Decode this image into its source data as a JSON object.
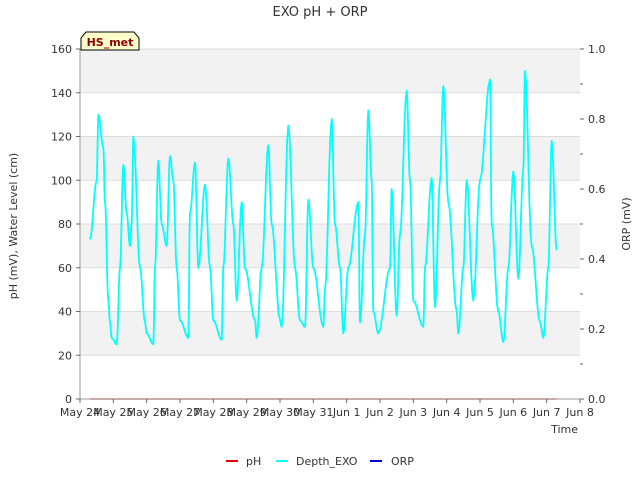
{
  "chart_data": {
    "type": "line",
    "title": "EXO pH + ORP",
    "xlabel": "Time",
    "ylabel_left": "pH (mV), Water Level (cm)",
    "ylabel_right": "ORP (mV)",
    "badge": "HS_met",
    "x_ticks": [
      "May 24",
      "May 25",
      "May 26",
      "May 27",
      "May 28",
      "May 29",
      "May 30",
      "May 31",
      "Jun 1",
      "Jun 2",
      "Jun 3",
      "Jun 4",
      "Jun 5",
      "Jun 6",
      "Jun 7",
      "Jun 8"
    ],
    "x_range_days": [
      0,
      15
    ],
    "y_left_ticks": [
      0,
      20,
      40,
      60,
      80,
      100,
      120,
      140,
      160
    ],
    "y_left_range": [
      0,
      160
    ],
    "y_right_ticks": [
      "0.0",
      "0.2",
      "0.4",
      "0.6",
      "0.8",
      "1.0"
    ],
    "y_right_range": [
      0,
      1.0
    ],
    "grid": true,
    "legend_placement": "bottom-center",
    "legend": [
      "pH",
      "Depth_EXO",
      "ORP"
    ],
    "series": [
      {
        "name": "pH",
        "color": "#dd0000",
        "axis": "left",
        "x": [
          0.3,
          14.3
        ],
        "values": [
          0,
          0
        ]
      },
      {
        "name": "Depth_EXO",
        "color": "#00ffff",
        "axis": "left",
        "x": [
          0.3,
          0.5,
          0.55,
          0.7,
          0.75,
          0.85,
          0.9,
          0.95,
          1.1,
          1.2,
          1.3,
          1.4,
          1.5,
          1.55,
          1.6,
          1.8,
          1.95,
          2.0,
          2.2,
          2.25,
          2.35,
          2.45,
          2.6,
          2.7,
          2.8,
          2.9,
          3.0,
          3.25,
          3.3,
          3.45,
          3.55,
          3.75,
          3.9,
          4.0,
          4.25,
          4.3,
          4.45,
          4.6,
          4.7,
          4.85,
          4.95,
          5.25,
          5.3,
          5.45,
          5.65,
          5.75,
          6.0,
          6.05,
          6.25,
          6.45,
          6.6,
          6.75,
          6.85,
          7.0,
          7.3,
          7.35,
          7.55,
          7.65,
          7.8,
          7.9,
          8.05,
          8.35,
          8.4,
          8.55,
          8.65,
          8.75,
          8.8,
          8.95,
          9.3,
          9.35,
          9.5,
          9.6,
          9.8,
          9.9,
          10.0,
          10.3,
          10.35,
          10.55,
          10.65,
          10.8,
          10.9,
          11.05,
          11.3,
          11.35,
          11.5,
          11.6,
          11.8,
          12.0,
          12.3,
          12.35,
          12.55,
          12.7,
          12.85,
          13.0,
          13.15,
          13.3,
          13.35,
          13.55,
          13.8,
          13.9,
          14.05,
          14.15,
          14.3
        ],
        "values": [
          73,
          100,
          130,
          115,
          90,
          45,
          35,
          28,
          25,
          60,
          107,
          85,
          70,
          80,
          120,
          60,
          35,
          30,
          25,
          60,
          109,
          80,
          70,
          111,
          100,
          60,
          36,
          28,
          85,
          108,
          60,
          98,
          60,
          36,
          27,
          60,
          110,
          80,
          45,
          90,
          60,
          36,
          28,
          60,
          116,
          80,
          36,
          33,
          125,
          60,
          36,
          33,
          91,
          60,
          33,
          50,
          128,
          80,
          60,
          30,
          60,
          90,
          35,
          75,
          132,
          100,
          40,
          30,
          60,
          96,
          38,
          75,
          141,
          100,
          45,
          33,
          60,
          101,
          42,
          100,
          143,
          90,
          40,
          30,
          60,
          100,
          45,
          100,
          146,
          80,
          40,
          26,
          60,
          104,
          55,
          105,
          150,
          70,
          35,
          28,
          60,
          118,
          68
        ]
      },
      {
        "name": "ORP",
        "color": "#0000cc",
        "axis": "right",
        "x": [],
        "values": []
      }
    ]
  }
}
